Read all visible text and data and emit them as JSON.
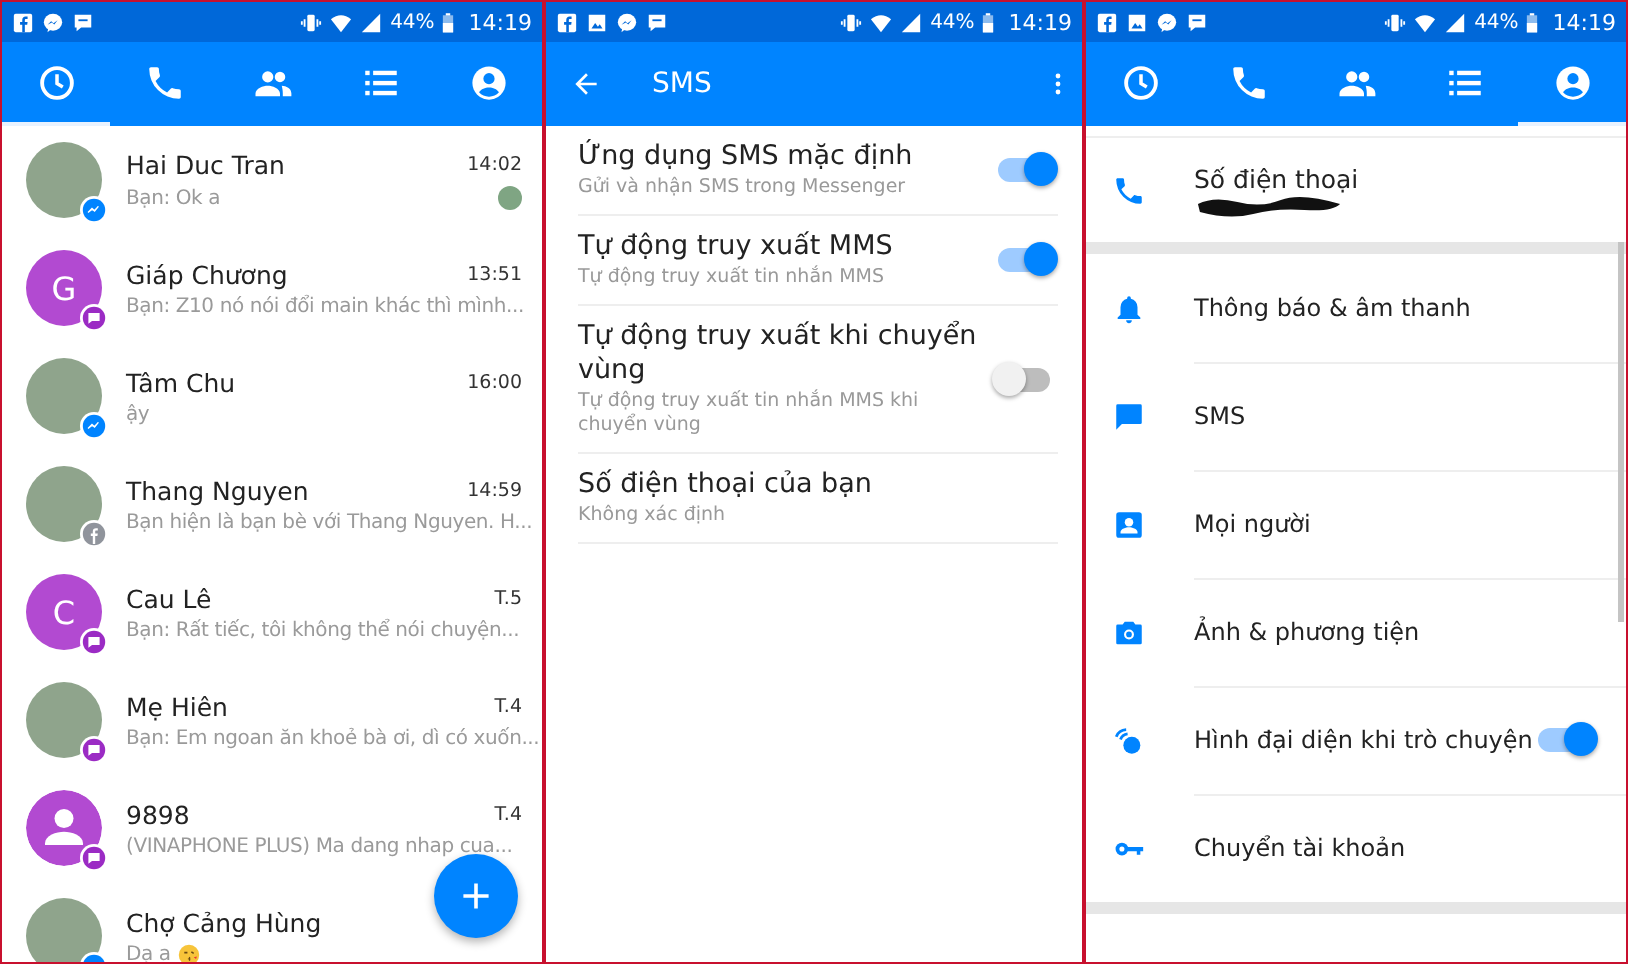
{
  "panels": [
    {
      "kind": "chats",
      "status_bar": {
        "notifications": [
          {
            "kind": "facebook"
          },
          {
            "kind": "messenger"
          },
          {
            "kind": "chat"
          }
        ],
        "battery": "44%",
        "time": "14:19"
      },
      "tabs": [
        {
          "selected": true
        },
        {
          "selected": false
        },
        {
          "selected": false
        },
        {
          "selected": false
        },
        {
          "selected": false
        }
      ],
      "conversations": [
        {
          "name": "Hai Duc Tran",
          "preview": "Bạn: Ok a",
          "time": "14:02",
          "avatar": {
            "kind": "photo"
          },
          "badge": {
            "kind": "messenger"
          },
          "seen": true
        },
        {
          "name": "Giáp Chương",
          "preview": "Bạn: Z10 nó nói đổi main khác thì mình...",
          "time": "13:51",
          "avatar": {
            "kind": "letter",
            "letter": "G"
          },
          "badge": {
            "kind": "sms"
          },
          "seen": false
        },
        {
          "name": "Tâm Chu",
          "preview": "ậy",
          "time": "16:00",
          "avatar": {
            "kind": "photo"
          },
          "badge": {
            "kind": "messenger"
          },
          "seen": false
        },
        {
          "name": "Thang Nguyen",
          "preview": "Bạn hiện là bạn bè với Thang Nguyen. H...",
          "time": "14:59",
          "avatar": {
            "kind": "photo"
          },
          "badge": {
            "kind": "facebook"
          },
          "seen": false
        },
        {
          "name": "Cau Lê",
          "preview": "Bạn: Rất tiếc, tôi không thể nói chuyện...",
          "time": "T.5",
          "avatar": {
            "kind": "letter",
            "letter": "C"
          },
          "badge": {
            "kind": "sms"
          },
          "seen": false
        },
        {
          "name": "Mẹ Hiên",
          "preview": "Bạn: Em ngoan ăn khoẻ bà ơi, dì có xuốn...",
          "time": "T.4",
          "avatar": {
            "kind": "photo"
          },
          "badge": {
            "kind": "sms"
          },
          "seen": false
        },
        {
          "name": "9898",
          "preview": "(VINAPHONE PLUS) Ma dang nhap cua...",
          "time": "T.4",
          "avatar": {
            "kind": "person"
          },
          "badge": {
            "kind": "sms"
          },
          "seen": false
        },
        {
          "name": "Chợ Cảng Hùng",
          "preview": "Dạ a",
          "avatar": {
            "kind": "photo"
          },
          "badge": {
            "kind": "messenger"
          },
          "seen": false
        }
      ]
    },
    {
      "kind": "sms_settings",
      "status_bar": {
        "notifications": [
          {
            "kind": "facebook"
          },
          {
            "kind": "gallery"
          },
          {
            "kind": "messenger"
          },
          {
            "kind": "chat"
          }
        ],
        "battery": "44%",
        "time": "14:19"
      },
      "title": "SMS",
      "settings": [
        {
          "title": "Ứng dụng SMS mặc định",
          "subtitle": "Gửi và nhận SMS trong Messenger",
          "on": true
        },
        {
          "title": "Tự động truy xuất MMS",
          "subtitle": "Tự động truy xuất tin nhắn MMS",
          "on": true
        },
        {
          "title": "Tự động truy xuất khi chuyển vùng",
          "subtitle": "Tự động truy xuất tin nhắn MMS khi chuyển vùng",
          "on": false
        },
        {
          "title": "Số điện thoại của bạn",
          "subtitle": "Không xác định"
        }
      ]
    },
    {
      "kind": "profile",
      "status_bar": {
        "notifications": [
          {
            "kind": "facebook"
          },
          {
            "kind": "gallery"
          },
          {
            "kind": "messenger"
          },
          {
            "kind": "chat"
          }
        ],
        "battery": "44%",
        "time": "14:19"
      },
      "tabs": [
        {
          "selected": false
        },
        {
          "selected": false
        },
        {
          "selected": false
        },
        {
          "selected": false
        },
        {
          "selected": true
        }
      ],
      "phone": {
        "label": "Số điện thoại"
      },
      "items": [
        {
          "label": "Thông báo & âm thanh",
          "kind": "link"
        },
        {
          "label": "SMS",
          "kind": "link"
        },
        {
          "label": "Mọi người",
          "kind": "link"
        },
        {
          "label": "Ảnh & phương tiện",
          "kind": "link"
        },
        {
          "label": "Hình đại diện khi trò chuyện",
          "kind": "toggle",
          "on": true
        },
        {
          "label": "Chuyển tài khoản",
          "kind": "link"
        }
      ]
    }
  ]
}
